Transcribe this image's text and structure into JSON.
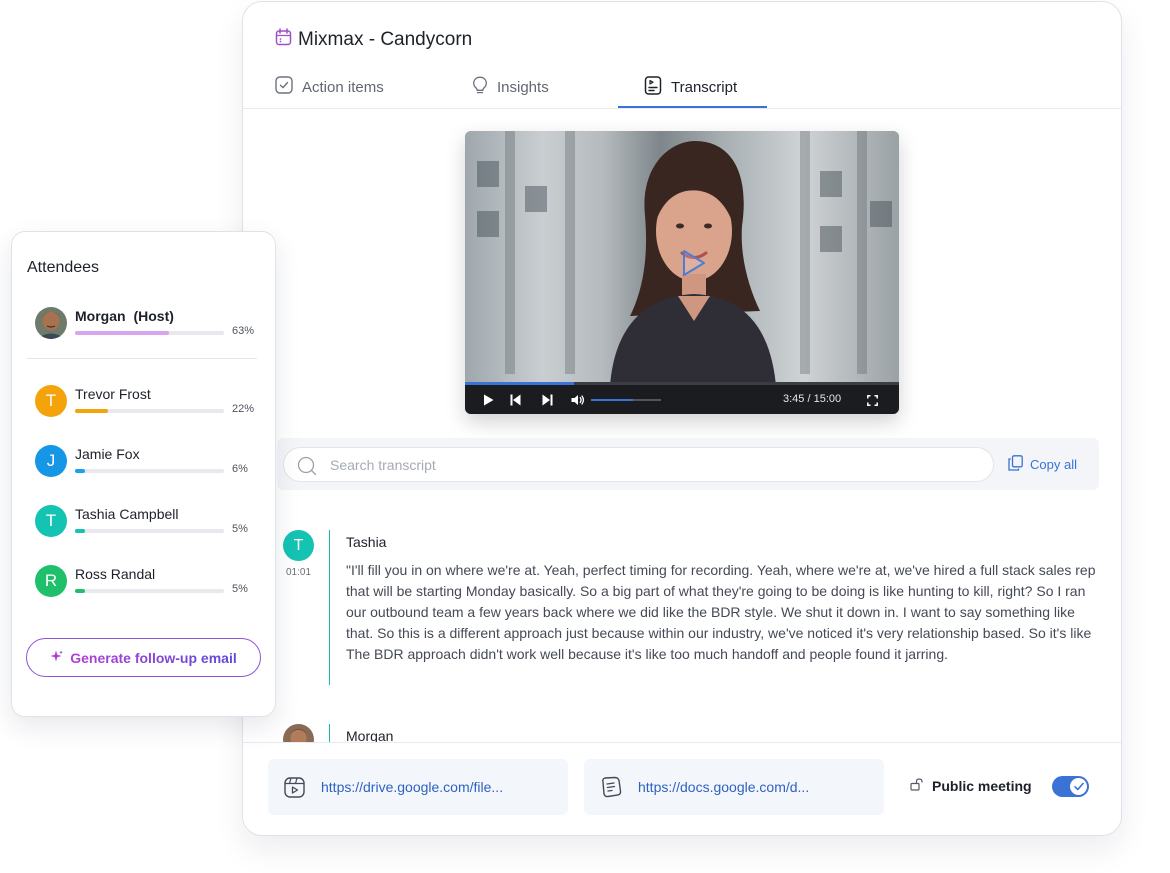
{
  "meeting": {
    "title": "Mixmax - Candycorn",
    "tabs": [
      {
        "label": "Action items",
        "icon": "check-square-icon",
        "active": false
      },
      {
        "label": "Insights",
        "icon": "lightbulb-icon",
        "active": false
      },
      {
        "label": "Transcript",
        "icon": "transcript-icon",
        "active": true
      }
    ]
  },
  "video": {
    "time_display": "3:45 / 15:00",
    "progress_fraction": 0.25,
    "volume_fraction": 0.6
  },
  "search": {
    "placeholder": "Search transcript",
    "copy_label": "Copy all"
  },
  "transcript": [
    {
      "speaker": "Tashia",
      "initial": "T",
      "avatar_color": "#15c3b3",
      "timestamp": "01:01",
      "text": "\"I'll fill you in on where we're at. Yeah, perfect timing for recording. Yeah, where we're at, we've hired a full stack sales rep that will be starting Monday basically. So a big part of what they're going to be doing is like hunting to kill, right? So I ran our outbound team a few years back where we did like the BDR style. We shut it down in. I want to say something like that. So this is a different approach just because within our industry, we've noticed it's very relationship based. So it's like The BDR approach didn't work well because it's like too much handoff and people found it jarring."
    },
    {
      "speaker": "Morgan",
      "avatar_icon": "person-photo-icon"
    }
  ],
  "footer": {
    "links": [
      {
        "url_text": "https://drive.google.com/file...",
        "icon": "video-file-icon"
      },
      {
        "url_text": "https://docs.google.com/d...",
        "icon": "document-icon"
      }
    ],
    "public_meeting_label": "Public meeting",
    "public_meeting_on": true
  },
  "attendees": {
    "title": "Attendees",
    "host": {
      "name": "Morgan",
      "role": "(Host)",
      "percent": "63%",
      "value": 0.63,
      "bar_color": "#dba4ef"
    },
    "list": [
      {
        "initial": "T",
        "name": "Trevor Frost",
        "percent": "22%",
        "value": 0.22,
        "avatar_color": "#f5a30b",
        "bar_color": "#f5a30b"
      },
      {
        "initial": "J",
        "name": "Jamie Fox",
        "percent": "6%",
        "value": 0.06,
        "avatar_color": "#1597e5",
        "bar_color": "#1aa3ec"
      },
      {
        "initial": "T",
        "name": "Tashia Campbell",
        "percent": "5%",
        "value": 0.05,
        "avatar_color": "#15c3b3",
        "bar_color": "#15c3b3"
      },
      {
        "initial": "R",
        "name": "Ross Randal",
        "percent": "5%",
        "value": 0.05,
        "avatar_color": "#1fbf6c",
        "bar_color": "#1fbf6c"
      }
    ],
    "generate_button": "Generate follow-up email"
  },
  "colors": {
    "accent": "#3a72d6",
    "button_gradient_start": "#b23fd3",
    "button_gradient_end": "#5b4ad8"
  }
}
